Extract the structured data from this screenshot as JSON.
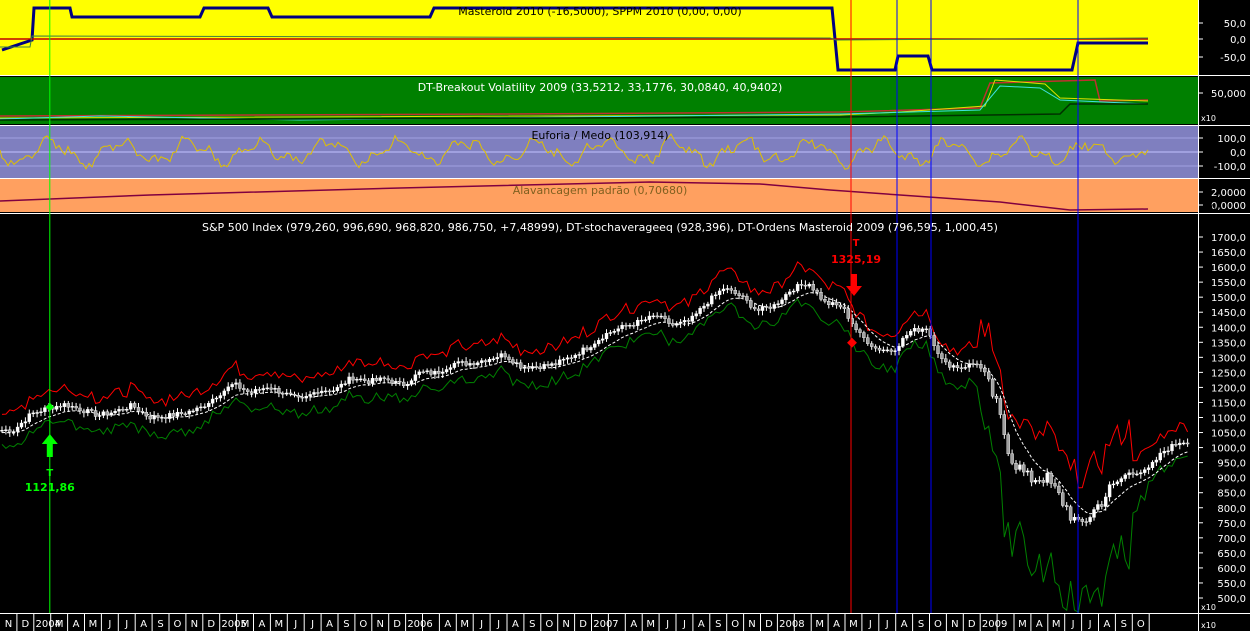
{
  "panels": {
    "masteroid": {
      "title": "Masteroid 2010 (-16,5000), SPPM 2010 (0,00, 0,00)",
      "scale_label": "x100",
      "ticks": [
        "50,0",
        "0,0",
        "-50,0"
      ],
      "tick_values": [
        50,
        0,
        -50
      ],
      "bg": "#ffff00"
    },
    "breakout": {
      "title": "DT-Breakout Volatility 2009 (33,5212, 33,1776, 30,0840, 40,9402)",
      "scale_label": "x10",
      "ticks": [
        "50,000"
      ],
      "tick_values": [
        50
      ],
      "bg": "#008000"
    },
    "euforia": {
      "title": "Euforia / Medo (103,914)",
      "scale_label": "x100",
      "ticks": [
        "100,0",
        "0,0",
        "-100,0"
      ],
      "tick_values": [
        100,
        0,
        -100
      ],
      "bg": "#7f7fbf"
    },
    "alavancagem": {
      "title": "Alavancagem padrão (0,70680)",
      "scale_label": "x10",
      "ticks": [
        "2,0000",
        "0,0000"
      ],
      "tick_values": [
        2,
        0
      ],
      "bg": "#ffa060"
    },
    "main": {
      "title": "S&P 500 Index (979,260, 996,690, 968,820, 986,750, +7,48999), DT-stochaverageeq (928,396), DT-Ordens Masteroid 2009 (796,595, 1,000,45)",
      "scale_label": "x10",
      "ticks": [
        "1700,0",
        "1650,0",
        "1600,0",
        "1550,0",
        "1500,0",
        "1450,0",
        "1400,0",
        "1350,0",
        "1300,0",
        "1250,0",
        "1200,0",
        "1150,0",
        "1100,0",
        "1050,0",
        "1000,0",
        "950,0",
        "900,0",
        "850,0",
        "800,0",
        "750,0",
        "700,0",
        "650,0",
        "600,0",
        "550,0",
        "500,0"
      ],
      "bg": "#000000"
    }
  },
  "signals": [
    {
      "type": "buy",
      "letter": "T",
      "price_label": "1121,86",
      "color": "#00ff00",
      "date": "2004-01"
    },
    {
      "type": "sell",
      "letter": "T",
      "price_label": "1325,19",
      "color": "#ff0000",
      "date": "2008-01"
    }
  ],
  "colors": {
    "candle_up": "#ffffff",
    "candle_down": "#a0a0a0",
    "upper_band": "#ff0000",
    "lower_band": "#008000",
    "average": "#ffffff",
    "vline_signal_buy": "#00ff00",
    "vline_signal_sell": "#ff0000",
    "vline_blue": "#0000ff"
  },
  "x_axis": {
    "months": [
      "N",
      "D",
      "2004",
      "M",
      "A",
      "M",
      "J",
      "J",
      "A",
      "S",
      "O",
      "N",
      "D",
      "2005",
      "M",
      "A",
      "M",
      "J",
      "J",
      "A",
      "S",
      "O",
      "N",
      "D",
      "2006",
      "",
      "A",
      "M",
      "J",
      "J",
      "A",
      "S",
      "O",
      "N",
      "D",
      "2007",
      "",
      "A",
      "M",
      "J",
      "J",
      "A",
      "S",
      "O",
      "N",
      "D",
      "2008",
      "",
      "M",
      "A",
      "M",
      "J",
      "J",
      "A",
      "S",
      "O",
      "N",
      "D",
      "2009",
      "",
      "M",
      "A",
      "M",
      "J",
      "J",
      "A",
      "S",
      "O"
    ],
    "scale_label": "x10"
  },
  "chart_data": {
    "type": "candlestick",
    "title": "S&P 500 Index (979,260, 996,690, 968,820, 986,750, +7,48999), DT-stochaverageeq (928,396), DT-Ordens Masteroid 2009 (796,595, 1,000,45)",
    "ylim": [
      500,
      1700
    ],
    "x_range": [
      "2003-11",
      "2009-10"
    ],
    "close_monthly": {
      "dates": [
        "2003-11",
        "2003-12",
        "2004-01",
        "2004-02",
        "2004-03",
        "2004-04",
        "2004-05",
        "2004-06",
        "2004-07",
        "2004-08",
        "2004-09",
        "2004-10",
        "2004-11",
        "2004-12",
        "2005-01",
        "2005-02",
        "2005-03",
        "2005-04",
        "2005-05",
        "2005-06",
        "2005-07",
        "2005-08",
        "2005-09",
        "2005-10",
        "2005-11",
        "2005-12",
        "2006-01",
        "2006-02",
        "2006-03",
        "2006-04",
        "2006-05",
        "2006-06",
        "2006-07",
        "2006-08",
        "2006-09",
        "2006-10",
        "2006-11",
        "2006-12",
        "2007-01",
        "2007-02",
        "2007-03",
        "2007-04",
        "2007-05",
        "2007-06",
        "2007-07",
        "2007-08",
        "2007-09",
        "2007-10",
        "2007-11",
        "2007-12",
        "2008-01",
        "2008-02",
        "2008-03",
        "2008-04",
        "2008-05",
        "2008-06",
        "2008-07",
        "2008-08",
        "2008-09",
        "2008-10",
        "2008-11",
        "2008-12",
        "2009-01",
        "2009-02",
        "2009-03",
        "2009-04",
        "2009-05",
        "2009-06",
        "2009-07",
        "2009-08"
      ],
      "values": [
        1058,
        1111,
        1131,
        1144,
        1126,
        1107,
        1120,
        1140,
        1101,
        1104,
        1114,
        1130,
        1173,
        1211,
        1181,
        1203,
        1180,
        1156,
        1191,
        1191,
        1234,
        1220,
        1228,
        1207,
        1249,
        1248,
        1280,
        1280,
        1294,
        1310,
        1270,
        1270,
        1276,
        1303,
        1335,
        1377,
        1400,
        1418,
        1438,
        1406,
        1420,
        1482,
        1530,
        1503,
        1455,
        1473,
        1526,
        1549,
        1481,
        1468,
        1378,
        1330,
        1322,
        1385,
        1400,
        1280,
        1267,
        1282,
        1166,
        968,
        896,
        903,
        825,
        735,
        797,
        872,
        919,
        919,
        987,
        1020
      ]
    },
    "series": [
      {
        "name": "DT-stochaverageeq",
        "style": "dashed white",
        "last": 928.396
      },
      {
        "name": "DT-Ordens Masteroid 2009",
        "upper_last": 1000.45,
        "lower_last": 796.595
      }
    ],
    "euforia_medo": 103.914,
    "alavancagem": 0.7068
  }
}
